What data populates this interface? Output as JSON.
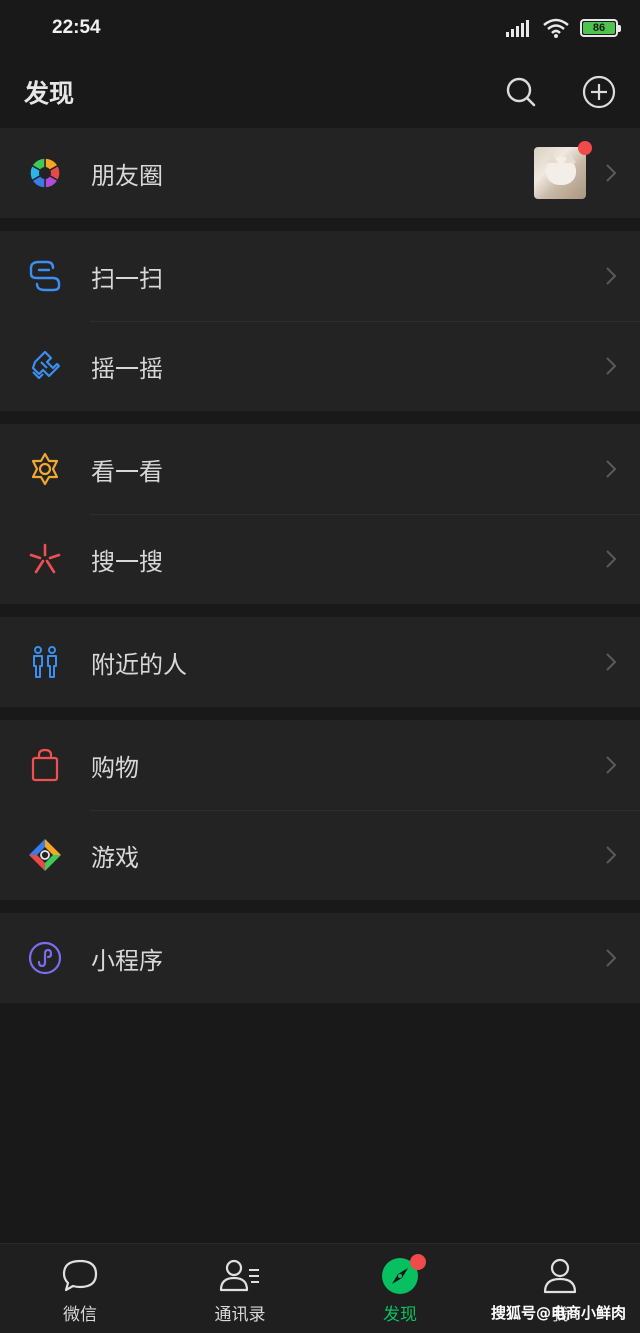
{
  "status": {
    "time": "22:54",
    "battery": "86"
  },
  "header": {
    "title": "发现"
  },
  "groups": [
    [
      {
        "label": "朋友圈",
        "icon": "moments-icon"
      }
    ],
    [
      {
        "label": "扫一扫",
        "icon": "scan-icon"
      },
      {
        "label": "摇一摇",
        "icon": "shake-icon"
      }
    ],
    [
      {
        "label": "看一看",
        "icon": "top-stories-icon"
      },
      {
        "label": "搜一搜",
        "icon": "search-search-icon"
      }
    ],
    [
      {
        "label": "附近的人",
        "icon": "people-nearby-icon"
      }
    ],
    [
      {
        "label": "购物",
        "icon": "shopping-bag-icon"
      },
      {
        "label": "游戏",
        "icon": "games-icon"
      }
    ],
    [
      {
        "label": "小程序",
        "icon": "mini-programs-icon"
      }
    ]
  ],
  "tabs": [
    {
      "label": "微信",
      "icon": "chat-icon"
    },
    {
      "label": "通讯录",
      "icon": "contacts-icon"
    },
    {
      "label": "发现",
      "icon": "discover-icon",
      "active": true
    },
    {
      "label": "我",
      "icon": "me-icon"
    }
  ],
  "watermark": "搜狐号@电商小鲜肉",
  "colors": {
    "accent": "#07c160",
    "badge": "#f04a4a",
    "background": "#191919",
    "cell": "#232323"
  }
}
